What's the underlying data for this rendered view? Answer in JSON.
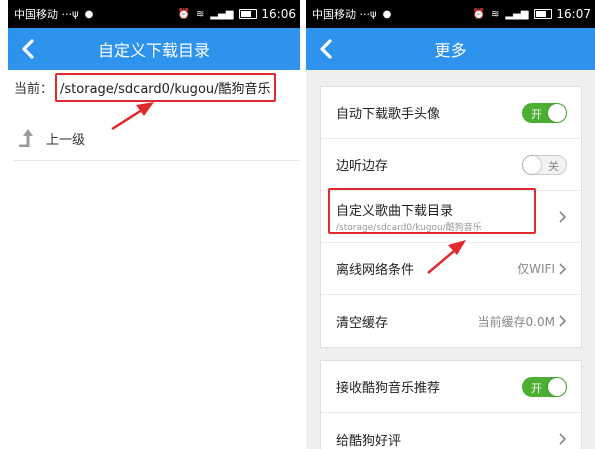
{
  "left": {
    "status": {
      "carrier": "中国移动 ···",
      "time": "16:06"
    },
    "title": "自定义下载目录",
    "path_prefix": "当前：",
    "path": "/storage/sdcard0/kugou/酷狗音乐",
    "up_label": "上一级"
  },
  "right": {
    "status": {
      "carrier": "中国移动 ···",
      "time": "16:07"
    },
    "title": "更多",
    "rows1": {
      "auto_avatar": {
        "label": "自动下载歌手头像",
        "toggle": "开",
        "state": "on"
      },
      "cache_play": {
        "label": "边听边存",
        "toggle": "关",
        "state": "off"
      },
      "custom_dir": {
        "label": "自定义歌曲下载目录",
        "sub": "/storage/sdcard0/kugou/酷狗音乐"
      },
      "offline": {
        "label": "离线网络条件",
        "value": "仅WIFI"
      },
      "clear_cache": {
        "label": "清空缓存",
        "value": "当前缓存0.0M"
      }
    },
    "rows2": {
      "recommend": {
        "label": "接收酷狗音乐推荐",
        "toggle": "开",
        "state": "on"
      },
      "rate": {
        "label": "给酷狗好评"
      }
    }
  },
  "colors": {
    "titlebar": "#2e93ec",
    "toggle_on": "#4caf32",
    "highlight": "#e0282e"
  }
}
